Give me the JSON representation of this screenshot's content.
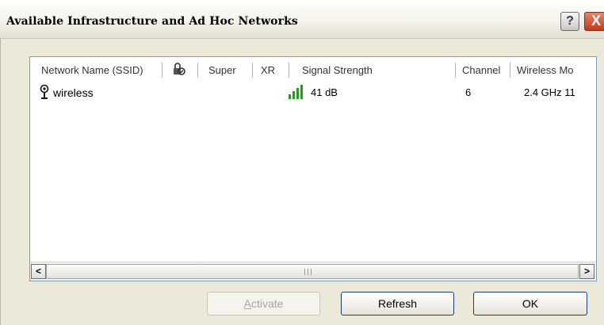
{
  "window": {
    "title": "Available Infrastructure and Ad Hoc Networks",
    "help_label": "?",
    "close_label": "X"
  },
  "table": {
    "columns": [
      "Network Name (SSID)",
      "Super",
      "XR",
      "Signal Strength",
      "Channel",
      "Wireless Mo"
    ],
    "rows": [
      {
        "ssid": "wireless",
        "signal": "41 dB",
        "channel": "6",
        "mode": "2.4 GHz 11",
        "signal_bars": 4,
        "signal_max": 4
      }
    ]
  },
  "scrollbar": {
    "left_arrow": "<",
    "right_arrow": ">"
  },
  "buttons": {
    "activate": "Activate",
    "refresh": "Refresh",
    "ok": "OK"
  },
  "colors": {
    "signal": "#1aa01a",
    "selection_border": "#1a3c7a"
  }
}
